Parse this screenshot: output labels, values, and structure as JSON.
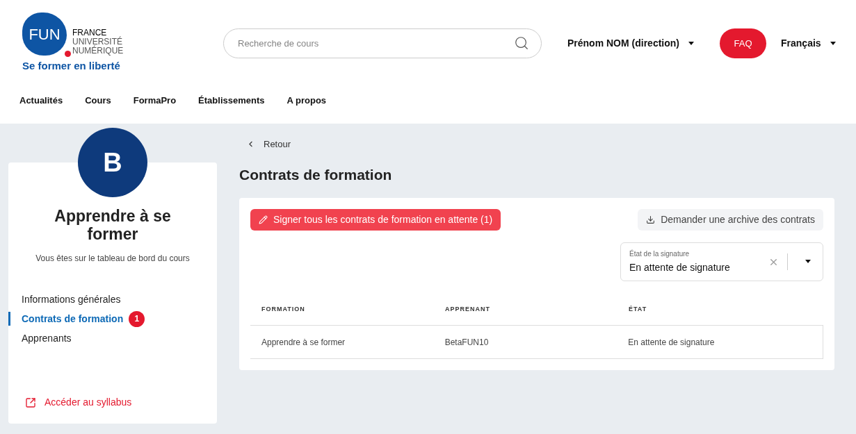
{
  "logo": {
    "mark": "FUN",
    "lines": [
      "FRANCE",
      "UNIVERSITÉ",
      "NUMÉRIQUE"
    ],
    "tagline": "Se former en liberté"
  },
  "search": {
    "placeholder": "Recherche de cours"
  },
  "user_menu": {
    "label": "Prénom NOM (direction)"
  },
  "faq_button": "FAQ",
  "language_menu": {
    "label": "Français"
  },
  "nav": [
    "Actualités",
    "Cours",
    "FormaPro",
    "Établissements",
    "A propos"
  ],
  "sidebar": {
    "avatar": "B",
    "title": "Apprendre à se former",
    "subtitle": "Vous êtes sur le tableau de bord du cours",
    "items": [
      {
        "label": "Informations générales",
        "selected": false
      },
      {
        "label": "Contrats de formation",
        "selected": true,
        "badge": "1"
      },
      {
        "label": "Apprenants",
        "selected": false
      }
    ],
    "syllabus_link": "Accéder au syllabus"
  },
  "back_link": "Retour",
  "page_title": "Contrats de formation",
  "sign_all_button": "Signer tous les contrats de formation en attente (1)",
  "archive_button": "Demander une archive des contrats",
  "filter": {
    "label": "État de la signature",
    "value": "En attente de signature"
  },
  "table": {
    "columns": [
      "FORMATION",
      "APPRENANT",
      "ÉTAT"
    ],
    "rows": [
      [
        "Apprendre à se former",
        "BetaFUN10",
        "En attente de signature"
      ]
    ]
  }
}
